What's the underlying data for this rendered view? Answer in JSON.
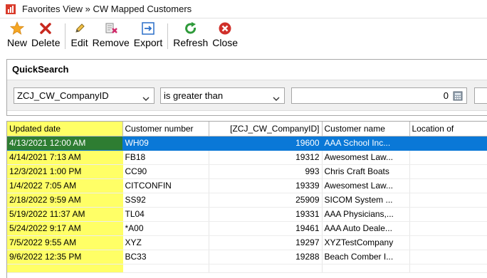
{
  "window": {
    "title": "Favorites View » CW Mapped Customers"
  },
  "toolbar": {
    "buttons": [
      {
        "label": "New",
        "icon": "star-icon"
      },
      {
        "label": "Delete",
        "icon": "red-x-icon"
      },
      {
        "label": "Edit",
        "icon": "pencil-icon"
      },
      {
        "label": "Remove",
        "icon": "remove-icon"
      },
      {
        "label": "Export",
        "icon": "export-icon"
      },
      {
        "label": "Refresh",
        "icon": "refresh-icon"
      },
      {
        "label": "Close",
        "icon": "close-circle-icon"
      }
    ]
  },
  "quicksearch": {
    "title": "QuickSearch",
    "field": "ZCJ_CW_CompanyID",
    "operator": "is greater than",
    "value": "0"
  },
  "grid": {
    "columns": [
      "Updated date",
      "Customer number",
      "[ZCJ_CW_CompanyID]",
      "Customer name",
      "Location of"
    ],
    "rows": [
      [
        "4/13/2021 12:00 AM",
        "WH09",
        "19600",
        "AAA School Inc..."
      ],
      [
        "4/14/2021 7:13 AM",
        "FB18",
        "19312",
        "Awesomest Law..."
      ],
      [
        "12/3/2021 1:00 PM",
        "CC90",
        "993",
        "Chris Craft Boats"
      ],
      [
        "1/4/2022 7:05 AM",
        "CITCONFIN",
        "19339",
        "Awesomest Law..."
      ],
      [
        "2/18/2022 9:59 AM",
        "SS92",
        "25909",
        "SICOM System ..."
      ],
      [
        "5/19/2022 11:37 AM",
        "TL04",
        "19331",
        "AAA Physicians,..."
      ],
      [
        "5/24/2022 9:17 AM",
        "*A00",
        "19461",
        "AAA Auto Deale..."
      ],
      [
        "7/5/2022 9:55 AM",
        "XYZ",
        "19297",
        "XYZTestCompany"
      ],
      [
        "9/6/2022 12:35 PM",
        "BC33",
        "19288",
        "Beach Comber I..."
      ]
    ],
    "selected_row": 0
  },
  "colors": {
    "highlight": "#ffff66",
    "selection": "#0a78d7",
    "selected_date": "#2e7d32"
  }
}
